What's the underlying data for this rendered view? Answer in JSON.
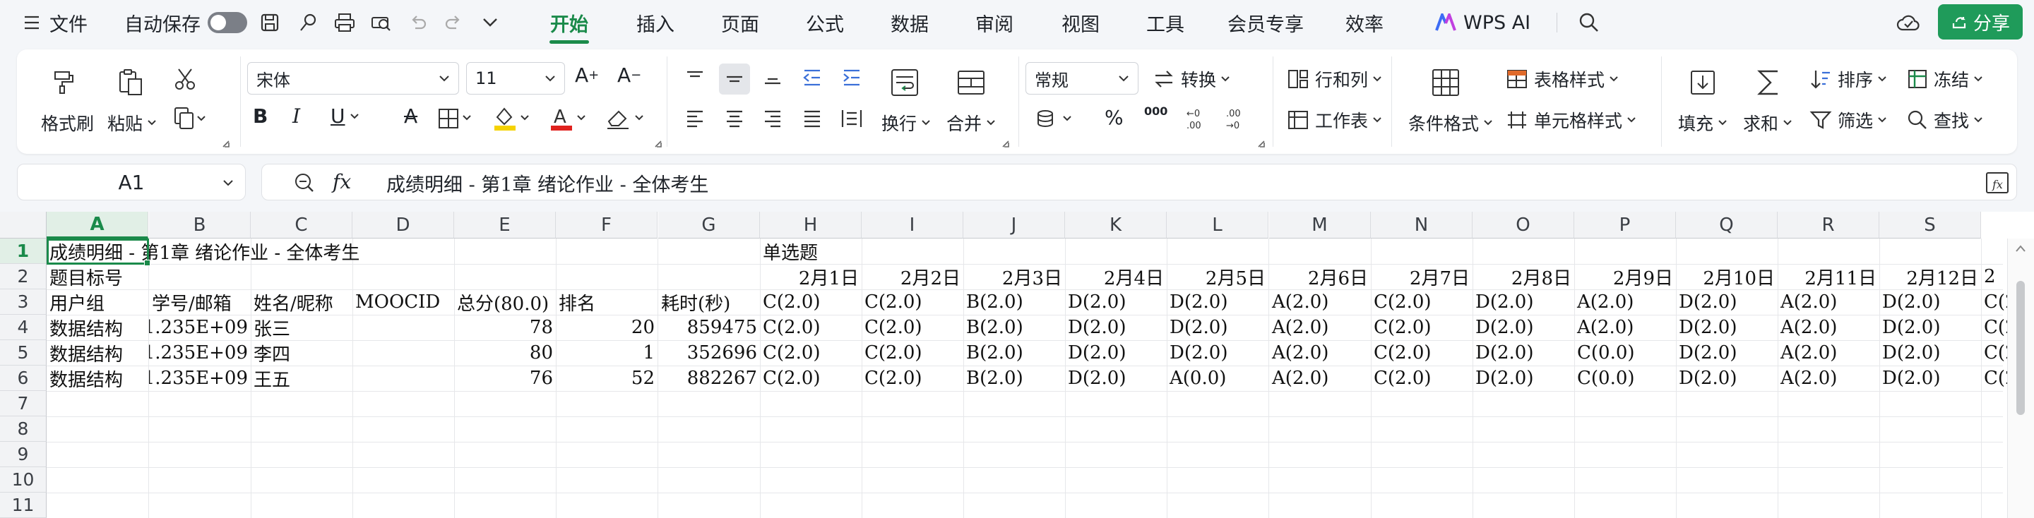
{
  "app": {
    "menu_label": "文件",
    "autosave_label": "自动保存",
    "tabs": [
      "开始",
      "插入",
      "页面",
      "公式",
      "数据",
      "审阅",
      "视图",
      "工具",
      "会员专享",
      "效率"
    ],
    "active_tab": "开始",
    "ai_label": "WPS AI",
    "share_label": "分享",
    "accent_color": "#1a8a4a"
  },
  "ribbon": {
    "format_painter": "格式刷",
    "paste": "粘贴",
    "font_name": "宋体",
    "font_size": "11",
    "wrap": "换行",
    "merge": "合并",
    "number_format": "常规",
    "convert": "转换",
    "rows_cols": "行和列",
    "worksheet": "工作表",
    "cond_format": "条件格式",
    "table_style": "表格样式",
    "cell_style": "单元格样式",
    "fill": "填充",
    "sum": "求和",
    "sort": "排序",
    "filter": "筛选",
    "freeze": "冻结",
    "find": "查找",
    "percent": "%",
    "thousands": "000"
  },
  "formula_bar": {
    "name_box": "A1",
    "fx": "fx",
    "content": "成绩明细 - 第1章 绪论作业 - 全体考生"
  },
  "sheet": {
    "columns": [
      "A",
      "B",
      "C",
      "D",
      "E",
      "F",
      "G",
      "H",
      "I",
      "J",
      "K",
      "L",
      "M",
      "N",
      "O",
      "P",
      "Q",
      "R",
      "S"
    ],
    "rows": [
      "1",
      "2",
      "3",
      "4",
      "5",
      "6",
      "7",
      "8",
      "9",
      "10",
      "11"
    ],
    "r1": {
      "a": "成绩明细 - 第1章 绪论作业 - 全体考生",
      "h": "单选题"
    },
    "r2": {
      "a": "题目标号",
      "dates": [
        "2月1日",
        "2月2日",
        "2月3日",
        "2月4日",
        "2月5日",
        "2月6日",
        "2月7日",
        "2月8日",
        "2月9日",
        "2月10日",
        "2月11日",
        "2月12日",
        "2"
      ]
    },
    "r3": [
      "用户组",
      "学号/邮箱",
      "姓名/昵称",
      "MOOCID",
      "总分(80.0)",
      "排名",
      "耗时(秒)",
      "C(2.0)",
      "C(2.0)",
      "B(2.0)",
      "D(2.0)",
      "D(2.0)",
      "A(2.0)",
      "C(2.0)",
      "D(2.0)",
      "A(2.0)",
      "D(2.0)",
      "A(2.0)",
      "D(2.0)",
      "C(2"
    ],
    "data_rows": [
      [
        "数据结构",
        "1.235E+09",
        "张三",
        "",
        "78",
        "20",
        "859475",
        "C(2.0)",
        "C(2.0)",
        "B(2.0)",
        "D(2.0)",
        "D(2.0)",
        "A(2.0)",
        "C(2.0)",
        "D(2.0)",
        "A(2.0)",
        "D(2.0)",
        "A(2.0)",
        "D(2.0)",
        "C(2"
      ],
      [
        "数据结构",
        "1.235E+09",
        "李四",
        "",
        "80",
        "1",
        "352696",
        "C(2.0)",
        "C(2.0)",
        "B(2.0)",
        "D(2.0)",
        "D(2.0)",
        "A(2.0)",
        "C(2.0)",
        "D(2.0)",
        "C(0.0)",
        "D(2.0)",
        "A(2.0)",
        "D(2.0)",
        "C(2"
      ],
      [
        "数据结构",
        "1.235E+09",
        "王五",
        "",
        "76",
        "52",
        "882267",
        "C(2.0)",
        "C(2.0)",
        "B(2.0)",
        "D(2.0)",
        "A(0.0)",
        "A(2.0)",
        "C(2.0)",
        "D(2.0)",
        "C(0.0)",
        "D(2.0)",
        "A(2.0)",
        "D(2.0)",
        "C(2"
      ]
    ]
  }
}
